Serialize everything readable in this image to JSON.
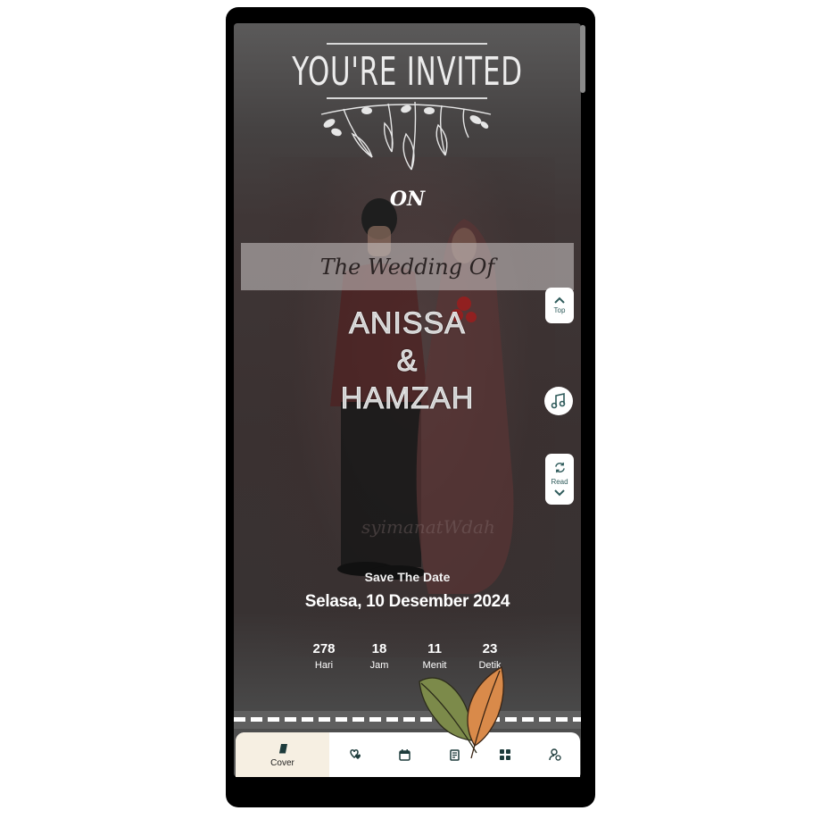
{
  "header": {
    "title": "YOU'RE INVITED",
    "on_text": "ON"
  },
  "banner": {
    "text": "The Wedding Of"
  },
  "couple": {
    "name1": "ANISSA",
    "amp": "&",
    "name2": "HAMZAH",
    "watermark": "syimanatWdah"
  },
  "save": {
    "title": "Save The Date",
    "date": "Selasa, 10 Desember 2024"
  },
  "countdown": [
    {
      "value": "278",
      "label": "Hari"
    },
    {
      "value": "18",
      "label": "Jam"
    },
    {
      "value": "11",
      "label": "Menit"
    },
    {
      "value": "23",
      "label": "Detik"
    }
  ],
  "side": {
    "top_label": "Top",
    "read_label": "Read"
  },
  "nav": {
    "items": [
      {
        "label": "Cover",
        "icon": "book-icon"
      },
      {
        "label": "",
        "icon": "hearts-icon"
      },
      {
        "label": "",
        "icon": "calendar-icon"
      },
      {
        "label": "",
        "icon": "document-icon"
      },
      {
        "label": "",
        "icon": "grid-icon"
      },
      {
        "label": "",
        "icon": "person-edit-icon"
      }
    ]
  },
  "colors": {
    "background": "#3a3131",
    "accent": "#2f5b5b",
    "nav_active": "#f6efe2"
  }
}
